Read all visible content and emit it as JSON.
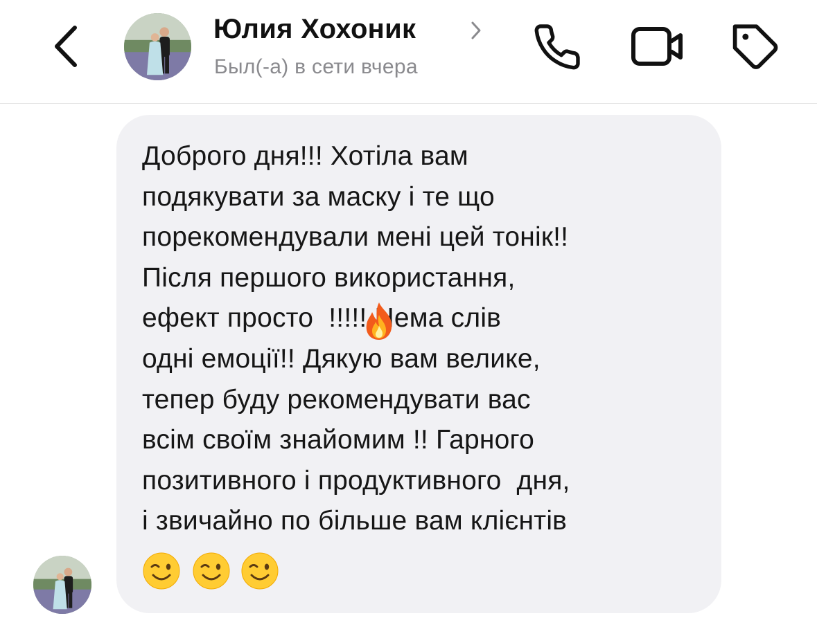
{
  "header": {
    "contact_name": "Юлия Хохоник",
    "status": "Был(-а) в сети вчера",
    "icons": {
      "back": "chevron-left-icon",
      "name_chevron": "chevron-right-icon",
      "call": "phone-icon",
      "video": "video-camera-icon",
      "tag": "tag-icon"
    }
  },
  "message": {
    "sender": "Юлия Хохоник",
    "bubble_color": "#f1f1f4",
    "lines_before_fire": "Доброго дня!!! Хотіла вам\nподякувати за маску і те що\nпорекомендували мені цей тонік!!\nПісля першого використання,\nефект просто",
    "fire_emoji": "🔥",
    "lines_after_fire": "  !!!!! Нема слів\nодні емоції!! Дякую вам велике,\nтепер буду рекомендувати вас\nвсім своїм знайомим !! Гарного\nпозитивного і продуктивного  дня,\nі звичайно по більше вам клієнтів",
    "trailing_emojis": [
      "😉",
      "😉",
      "😉"
    ]
  },
  "colors": {
    "text_primary": "#111111",
    "text_secondary": "#8a8a8e",
    "divider": "#e6e6e6",
    "bubble": "#f1f1f4"
  }
}
